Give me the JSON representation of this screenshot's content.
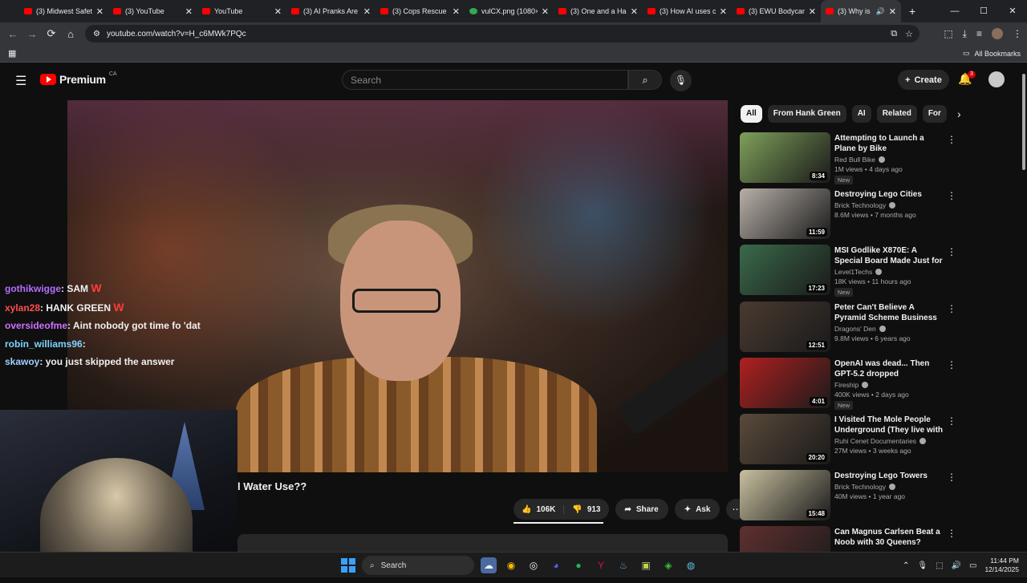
{
  "browser": {
    "tabs": [
      {
        "title": "(3) Midwest Safet",
        "icon": "youtube-icon"
      },
      {
        "title": "(3) YouTube",
        "icon": "youtube-icon"
      },
      {
        "title": "YouTube",
        "icon": "youtube-icon"
      },
      {
        "title": "(3) AI Pranks Are",
        "icon": "youtube-icon"
      },
      {
        "title": "(3) Cops Rescue M",
        "icon": "youtube-icon"
      },
      {
        "title": "vulCX.png (1080×",
        "icon": "image-icon"
      },
      {
        "title": "(3) One and a Hal",
        "icon": "youtube-icon"
      },
      {
        "title": "(3) How AI uses c",
        "icon": "youtube-icon"
      },
      {
        "title": "(3) EWU Bodycam",
        "icon": "youtube-icon"
      },
      {
        "title": "(3) Why is Eve",
        "icon": "youtube-icon",
        "active": true
      }
    ],
    "url": "youtube.com/watch?v=H_c6MWk7PQc",
    "bookmarks_label": "All Bookmarks"
  },
  "yt_header": {
    "logo_text": "Premium",
    "region": "CA",
    "search_placeholder": "Search",
    "create_label": "Create",
    "notification_count": "3"
  },
  "chat": [
    {
      "user": "gothikwigge",
      "msg": "SAM",
      "emote": "W"
    },
    {
      "user": "xylan28",
      "msg": "HANK GREEN",
      "emote": "W"
    },
    {
      "user": "oversideofme",
      "msg": "Aint nobody got time fo 'dat"
    },
    {
      "user": "robin_williams96",
      "msg": ""
    },
    {
      "user": "skawoy",
      "msg": "you just skipped the answer"
    }
  ],
  "video": {
    "title_fragment": "l Water Use??",
    "likes": "106K",
    "dislikes": "913",
    "share_label": "Share",
    "ask_label": "Ask"
  },
  "chips": [
    "All",
    "From Hank Green",
    "AI",
    "Related",
    "For"
  ],
  "recommendations": [
    {
      "title": "Attempting to Launch a Plane by Bike",
      "channel": "Red Bull Bike",
      "meta": "1M views • 4 days ago",
      "duration": "8:34",
      "new": "New",
      "thumb": "#7ea05a"
    },
    {
      "title": "Destroying Lego Cities",
      "channel": "Brick Technology",
      "meta": "8.6M views • 7 months ago",
      "duration": "11:59",
      "new": "",
      "thumb": "#b8b0a8"
    },
    {
      "title": "MSI Godlike X870E: A Special Board Made Just for Us!",
      "channel": "Level1Techs",
      "meta": "18K views • 11 hours ago",
      "duration": "17:23",
      "new": "New",
      "thumb": "#3a6a4a"
    },
    {
      "title": "Peter Can't Believe A Pyramid Scheme Business Model's ...",
      "channel": "Dragons' Den",
      "meta": "9.8M views • 6 years ago",
      "duration": "12:51",
      "new": "",
      "thumb": "#4a3a30"
    },
    {
      "title": "OpenAI was dead... Then GPT-5.2 dropped",
      "channel": "Fireship",
      "meta": "400K views • 2 days ago",
      "duration": "4:01",
      "new": "New",
      "thumb": "#b02020"
    },
    {
      "title": "I Visited The Mole People Underground (They live with n...",
      "channel": "Ruhi Cenet Documentaries",
      "meta": "27M views • 3 weeks ago",
      "duration": "20:20",
      "new": "",
      "thumb": "#5a4a3a"
    },
    {
      "title": "Destroying Lego Towers",
      "channel": "Brick Technology",
      "meta": "40M views • 1 year ago",
      "duration": "15:48",
      "new": "",
      "thumb": "#c8c0a0"
    },
    {
      "title": "Can Magnus Carlsen Beat a Noob with 30 Queens?",
      "channel": "",
      "meta": "",
      "duration": "",
      "new": "",
      "thumb": "#603030"
    }
  ],
  "taskbar": {
    "search_label": "Search",
    "time": "11:44 PM",
    "date": "12/14/2025"
  }
}
